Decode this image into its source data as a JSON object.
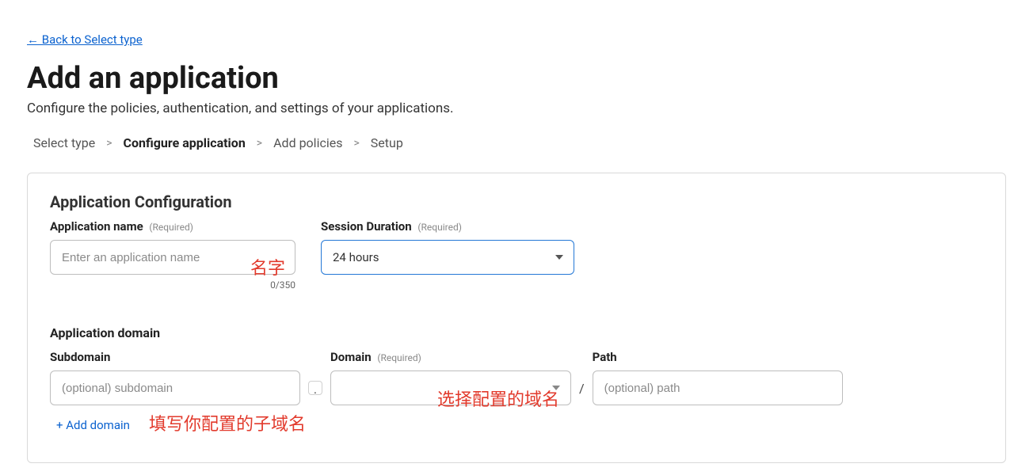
{
  "back_link": "← Back to Select type",
  "page_title": "Add an application",
  "page_subtitle": "Configure the policies, authentication, and settings of your applications.",
  "steps": {
    "s1": "Select type",
    "s2": "Configure application",
    "s3": "Add policies",
    "s4": "Setup",
    "sep": ">"
  },
  "panel": {
    "title": "Application Configuration",
    "app_name_label": "Application name",
    "required": "(Required)",
    "app_name_placeholder": "Enter an application name",
    "app_name_counter": "0/350",
    "session_label": "Session Duration",
    "session_value": "24 hours",
    "domain_section_title": "Application domain",
    "subdomain_label": "Subdomain",
    "subdomain_placeholder": "(optional) subdomain",
    "domain_label": "Domain",
    "path_label": "Path",
    "path_placeholder": "(optional) path",
    "dot": ".",
    "slash": "/",
    "add_domain": "+ Add domain"
  },
  "annotations": {
    "name": "名字",
    "domain": "选择配置的域名",
    "subdomain": "填写你配置的子域名"
  }
}
